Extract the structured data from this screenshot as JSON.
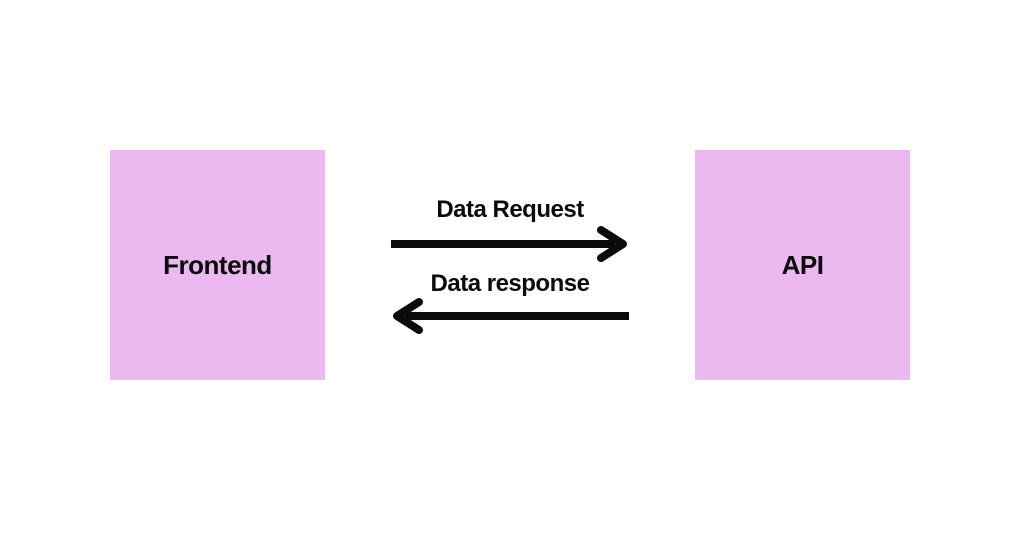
{
  "diagram": {
    "left_box_label": "Frontend",
    "right_box_label": "API",
    "request_label": "Data Request",
    "response_label": "Data response",
    "box_color": "#ebb8f0",
    "text_color": "#0b0b0b",
    "arrow_color": "#0b0b0b"
  }
}
